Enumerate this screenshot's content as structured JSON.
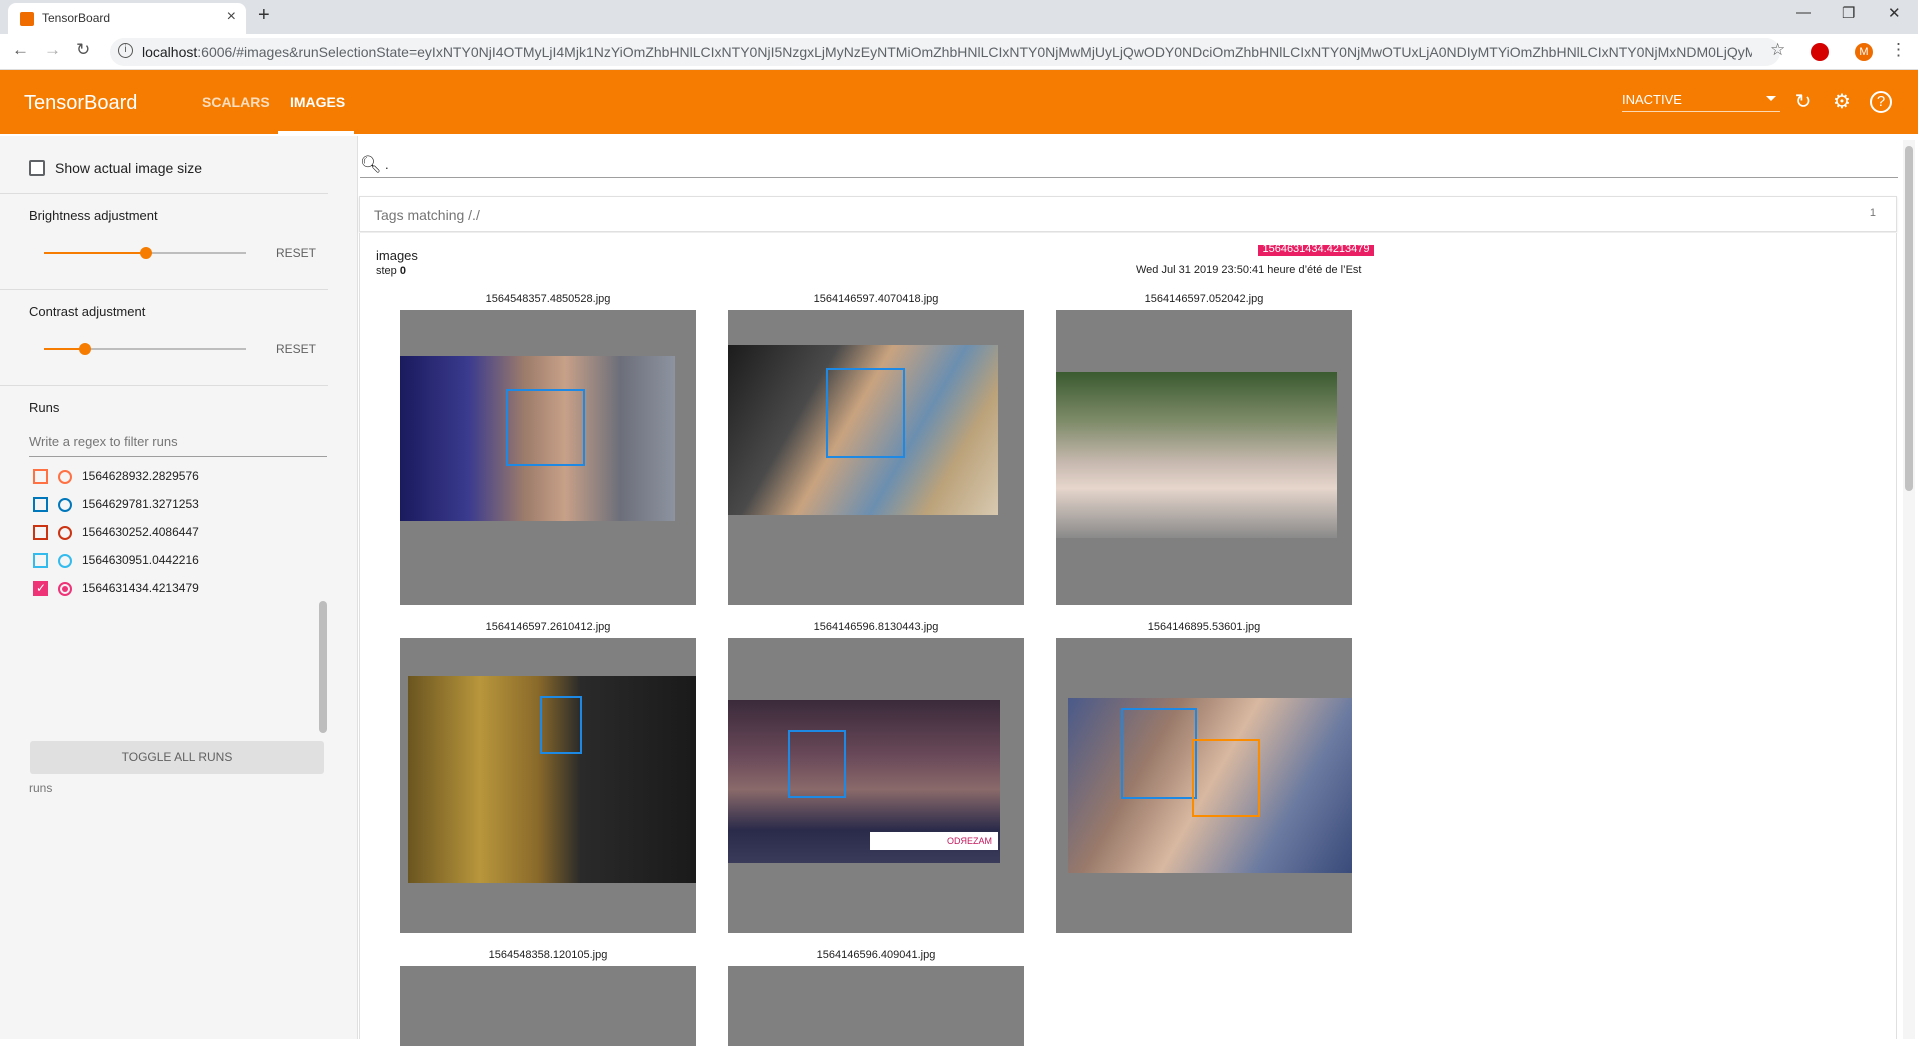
{
  "browser": {
    "tab_title": "TensorBoard",
    "new_tab": "+",
    "url_host": "localhost",
    "url_rest": ":6006/#images&runSelectionState=eyIxNTY0NjI4OTMyLjI4Mjk1NzYiOmZhbHNlLCIxNTY0NjI5NzgxLjMyNzEyNTMiOmZhbHNlLCIxNTY0NjMwMjUyLjQwODY0NDciOmZhbHNlLCIxNTY0NjMwOTUxLjA0NDIyMTYiOmZhbHNlLCIxNTY0NjMxNDM0LjQyMTM0..."
  },
  "header": {
    "brand": "TensorBoard",
    "tabs": [
      {
        "label": "SCALARS"
      },
      {
        "label": "IMAGES"
      }
    ],
    "status": "INACTIVE"
  },
  "sidebar": {
    "show_actual_size": "Show actual image size",
    "brightness": {
      "label": "Brightness adjustment",
      "reset": "RESET",
      "value": 0.5
    },
    "contrast": {
      "label": "Contrast adjustment",
      "reset": "RESET",
      "value": 0.2
    },
    "runs_title": "Runs",
    "filter_placeholder": "Write a regex to filter runs",
    "runs": [
      {
        "name": "1564628932.2829576",
        "color": "#ff7043",
        "checked": false
      },
      {
        "name": "1564629781.3271253",
        "color": "#0077bb",
        "checked": false
      },
      {
        "name": "1564630252.4086447",
        "color": "#cc3311",
        "checked": false
      },
      {
        "name": "1564630951.0442216",
        "color": "#33bbee",
        "checked": false
      },
      {
        "name": "1564631434.4213479",
        "color": "#ee3377",
        "checked": true
      }
    ],
    "toggle_all": "TOGGLE ALL RUNS",
    "footer": "runs"
  },
  "main": {
    "search_value": ".",
    "tags_matching": "Tags matching /./",
    "tags_count": "1",
    "card_title": "images",
    "step_label": "step",
    "step_value": "0",
    "run_badge": "1564631434.4213479",
    "timestamp": "Wed Jul 31 2019 23:50:41 heure d’été de l’Est",
    "images": [
      {
        "caption": "1564548357.4850528.jpg"
      },
      {
        "caption": "1564146597.4070418.jpg"
      },
      {
        "caption": "1564146597.052042.jpg"
      },
      {
        "caption": "1564146597.2610412.jpg"
      },
      {
        "caption": "1564146596.8130443.jpg"
      },
      {
        "caption": "1564146895.53601.jpg"
      },
      {
        "caption": "1564548358.120105.jpg"
      },
      {
        "caption": "1564146596.409041.jpg"
      }
    ],
    "tv_text": "ODЯEZAM"
  },
  "colors": {
    "accent": "#f57c00",
    "box_blue": "#1e88e5",
    "box_orange": "#fb8c00",
    "badge": "#e91e63"
  }
}
